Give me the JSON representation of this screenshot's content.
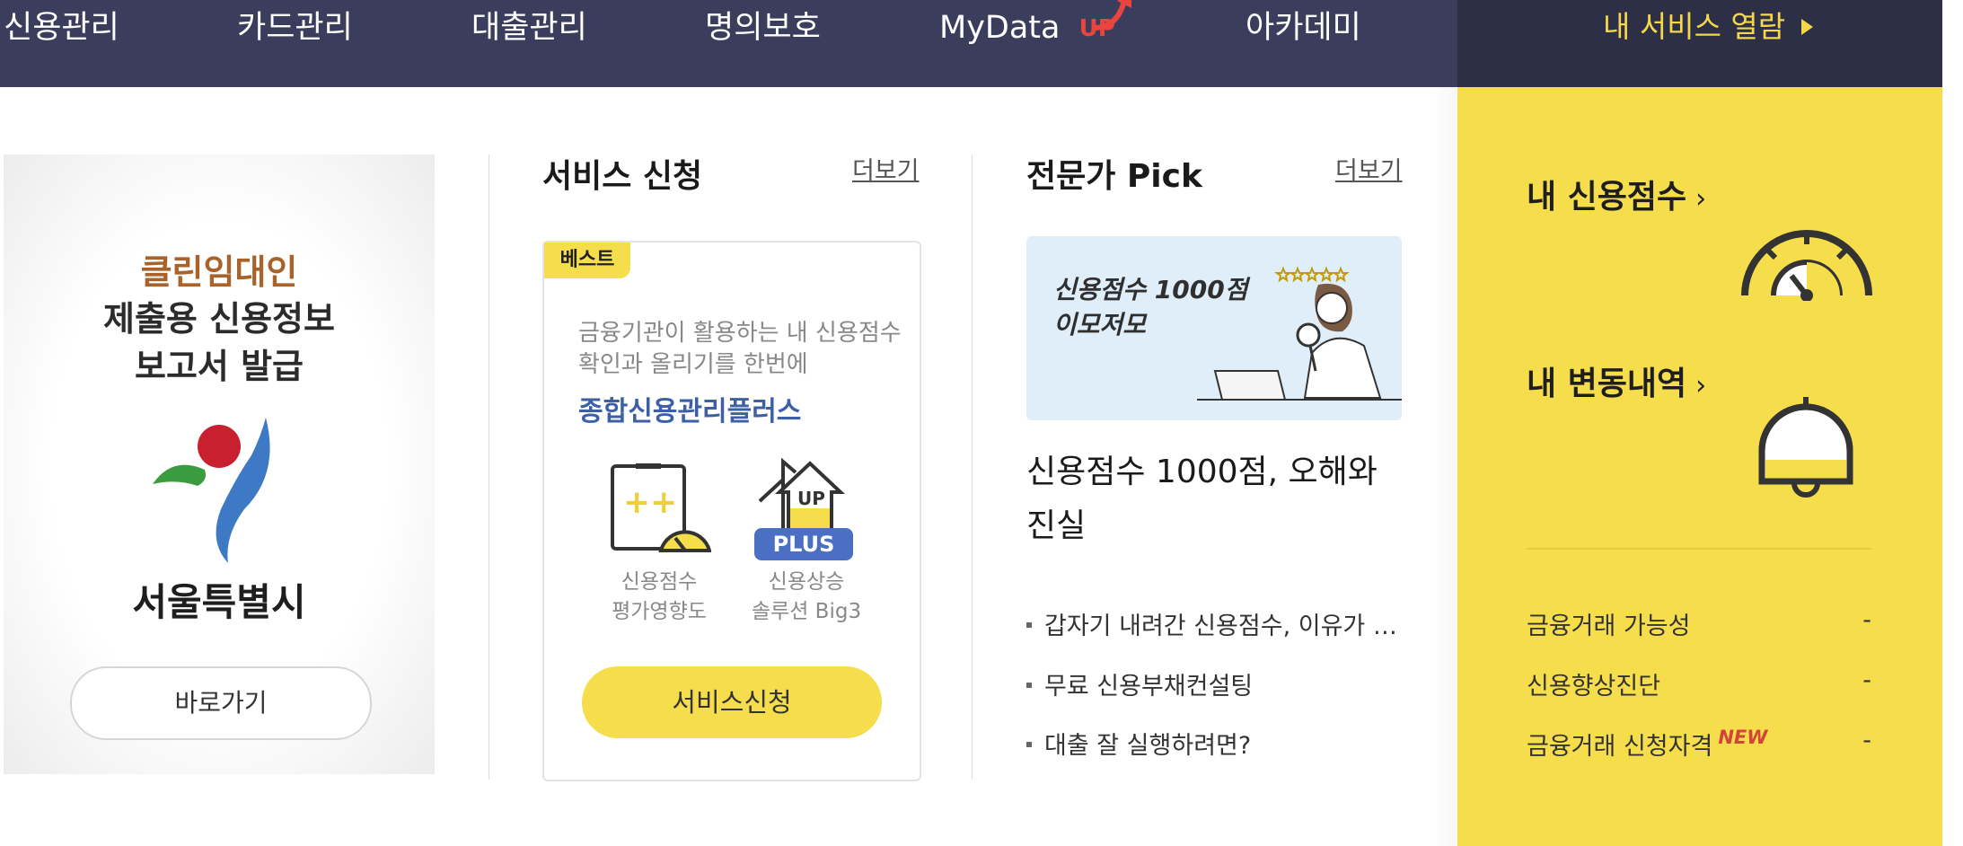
{
  "nav": {
    "items": [
      "신용관리",
      "카드관리",
      "대출관리",
      "명의보호",
      "MyData",
      "아카데미"
    ],
    "mydata_badge": "UP",
    "my_services": "내 서비스 열람"
  },
  "banner": {
    "line1": "클린임대인",
    "line2": "제출용 신용정보",
    "line3": "보고서 발급",
    "city": "서울특별시",
    "button": "바로가기"
  },
  "service": {
    "title": "서비스 신청",
    "more": "더보기",
    "badge": "베스트",
    "desc1": "금융기관이 활용하는 내 신용점수",
    "desc2": "확인과 올리기를 한번에",
    "product": "종합신용관리플러스",
    "icon1_line1": "신용점수",
    "icon1_line2": "평가영향도",
    "icon2_line1": "신용상승",
    "icon2_line2": "솔루션 Big3",
    "icon2_up": "UP",
    "icon2_plus": "PLUS",
    "button": "서비스신청"
  },
  "expert": {
    "title": "전문가 Pick",
    "more": "더보기",
    "thumb_line1": "신용점수 1000점",
    "thumb_line2": "이모저모",
    "headline": "신용점수 1000점, 오해와 진실",
    "list": [
      "갑자기 내려간 신용점수, 이유가 …",
      "무료 신용부채컨설팅",
      "대출 잘 실행하려면?"
    ]
  },
  "panel": {
    "credit_score": "내 신용점수",
    "changes": "내 변동내역",
    "chevron": "›",
    "rows": [
      {
        "label": "금융거래 가능성",
        "value": "-"
      },
      {
        "label": "신용향상진단",
        "value": "-"
      },
      {
        "label": "금융거래 신청자격",
        "value": "-",
        "badge": "NEW"
      }
    ]
  },
  "colors": {
    "nav_bg": "#3b3d5c",
    "accent_yellow": "#f5dd4b",
    "product_blue": "#3d5fa6",
    "new_red": "#d2453b"
  }
}
